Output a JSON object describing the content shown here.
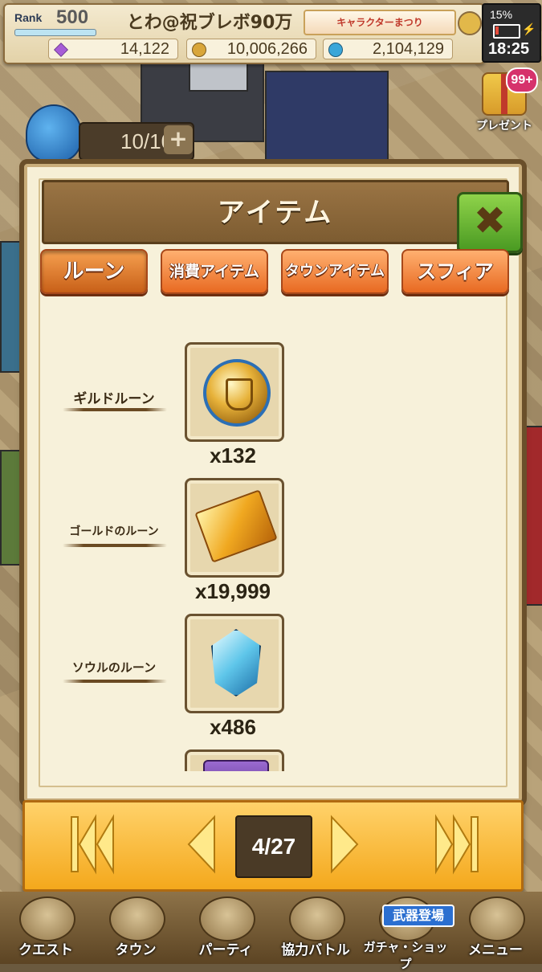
{
  "hud": {
    "rank_label": "Rank",
    "rank_value": "500",
    "player_name": "とわ@祝ブレボ90万",
    "event_banner": "キャラクターまつり",
    "gems": "14,122",
    "gold": "10,006,266",
    "souls": "2,104,129"
  },
  "status_bar": {
    "battery": "15%",
    "time": "18:25"
  },
  "present": {
    "badge": "99+",
    "label": "プレゼント"
  },
  "energy": {
    "value": "10/10",
    "plus": "+"
  },
  "dialog": {
    "title": "アイテム",
    "close_symbol": "✖",
    "tabs": [
      {
        "label": "ルーン",
        "active": true
      },
      {
        "label": "消費アイテム",
        "active": false
      },
      {
        "label": "タウンアイテム",
        "active": false
      },
      {
        "label": "スフィア",
        "active": false
      }
    ],
    "items": [
      {
        "label": "ギルドルーン",
        "count": "x132",
        "icon": "guild-rune-icon"
      },
      {
        "label": "ゴールドのルーン",
        "count": "x19,999",
        "icon": "gold-rune-icon"
      },
      {
        "label": "ソウルのルーン",
        "count": "x486",
        "icon": "soul-rune-icon"
      }
    ]
  },
  "pager": {
    "page": "4/27"
  },
  "bottom_nav": {
    "items": [
      {
        "label": "クエスト"
      },
      {
        "label": "タウン"
      },
      {
        "label": "パーティ"
      },
      {
        "label": "協力バトル"
      },
      {
        "label": "ガチャ・ショップ"
      },
      {
        "label": "メニュー"
      }
    ],
    "banner": "武器登場"
  }
}
